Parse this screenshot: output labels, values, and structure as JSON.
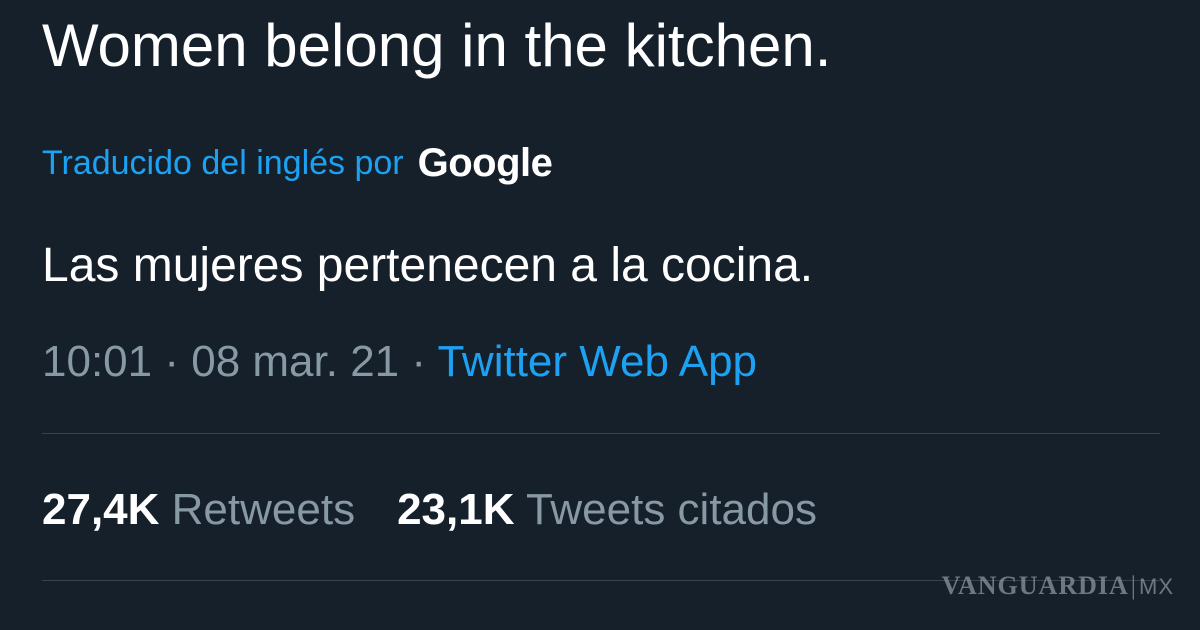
{
  "tweet": {
    "text": "Women belong in the kitchen.",
    "translation_label": "Traducido del inglés por",
    "translation_provider": "Google",
    "translated_text": "Las mujeres pertenecen a la cocina.",
    "time": "10:01",
    "date": "08 mar. 21",
    "separator": "·",
    "source": "Twitter Web App"
  },
  "stats": [
    {
      "count": "27,4K",
      "label": "Retweets"
    },
    {
      "count": "23,1K",
      "label": "Tweets citados"
    }
  ],
  "watermark": {
    "brand": "VANGUARDIA",
    "separator": "|",
    "suffix": "MX"
  },
  "colors": {
    "background": "#15202b",
    "accent": "#1da1f2",
    "secondary_text": "#8899a6",
    "divider": "#38444d"
  }
}
